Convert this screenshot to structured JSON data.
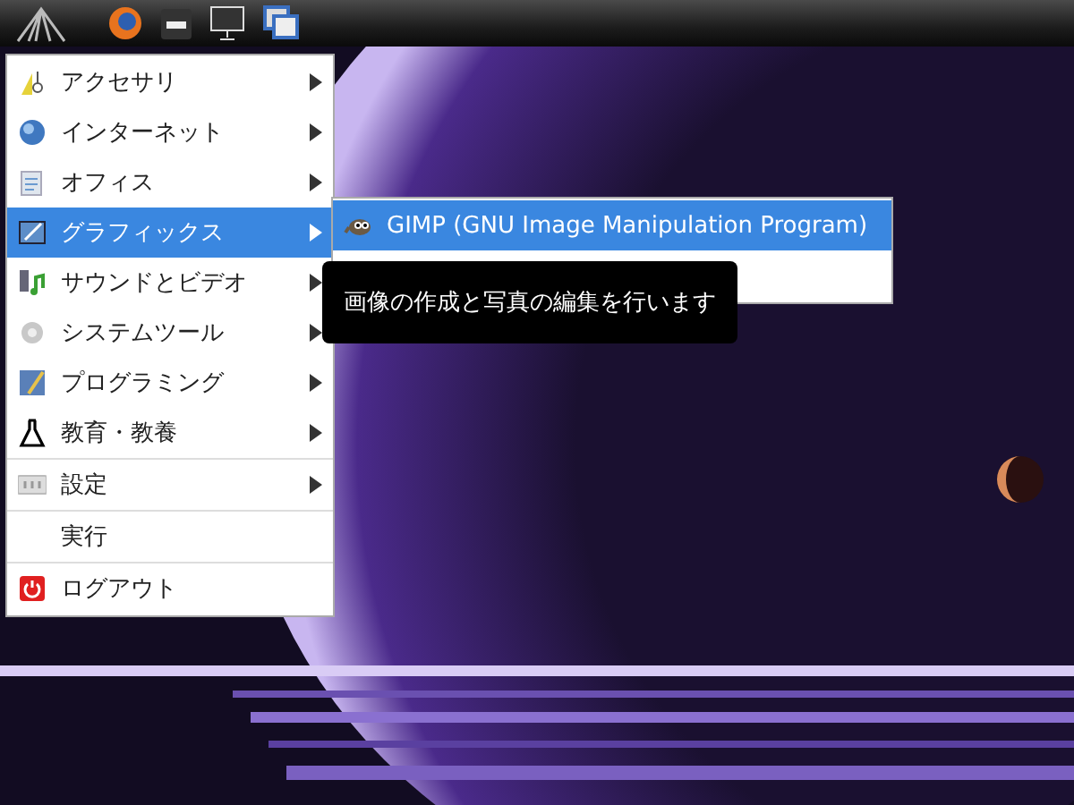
{
  "main_menu": {
    "items": [
      {
        "label": "アクセサリ",
        "submenu": true,
        "selected": false,
        "separator_before": false
      },
      {
        "label": "インターネット",
        "submenu": true,
        "selected": false,
        "separator_before": false
      },
      {
        "label": "オフィス",
        "submenu": true,
        "selected": false,
        "separator_before": false
      },
      {
        "label": "グラフィックス",
        "submenu": true,
        "selected": true,
        "separator_before": false
      },
      {
        "label": "サウンドとビデオ",
        "submenu": true,
        "selected": false,
        "separator_before": false
      },
      {
        "label": "システムツール",
        "submenu": true,
        "selected": false,
        "separator_before": false
      },
      {
        "label": "プログラミング",
        "submenu": true,
        "selected": false,
        "separator_before": false
      },
      {
        "label": "教育・教養",
        "submenu": true,
        "selected": false,
        "separator_before": false
      },
      {
        "label": "設定",
        "submenu": true,
        "selected": false,
        "separator_before": true
      },
      {
        "label": "実行",
        "submenu": false,
        "selected": false,
        "separator_before": true
      },
      {
        "label": "ログアウト",
        "submenu": false,
        "selected": false,
        "separator_before": true
      }
    ]
  },
  "submenu": {
    "items": [
      {
        "label": "GIMP (GNU Image Manipulation Program)",
        "selected": true
      }
    ]
  },
  "tooltip": "画像の作成と写真の編集を行います"
}
